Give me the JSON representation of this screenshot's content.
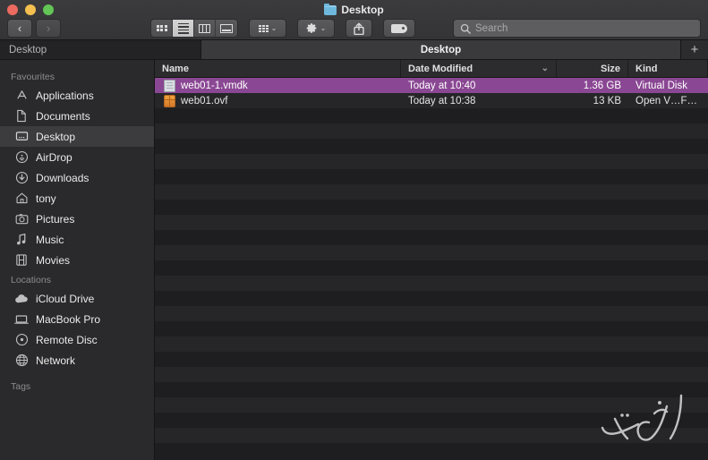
{
  "window": {
    "title": "Desktop",
    "title_icon": "folder-icon",
    "traffic_lights": [
      {
        "name": "close-button",
        "color": "#ec6a5f"
      },
      {
        "name": "minimize-button",
        "color": "#f5bf4f"
      },
      {
        "name": "zoom-button",
        "color": "#62c555"
      }
    ]
  },
  "toolbar": {
    "back_label": "‹",
    "forward_label": "›",
    "view_modes": [
      {
        "name": "icon-view",
        "icon": "grid-icon",
        "active": false
      },
      {
        "name": "list-view",
        "icon": "list-icon",
        "active": true
      },
      {
        "name": "column-view",
        "icon": "columns-icon",
        "active": false
      },
      {
        "name": "gallery-view",
        "icon": "gallery-icon",
        "active": false
      }
    ],
    "group_icon": "group-by-icon",
    "group_chevron": "⌄",
    "action_icon": "gear-icon",
    "action_chevron": "⌄",
    "share_icon": "share-icon",
    "tag_icon": "tag-icon"
  },
  "search": {
    "icon": "search-icon",
    "placeholder": "Search",
    "value": ""
  },
  "tabs": {
    "items": [
      {
        "label": "Desktop",
        "active": false
      },
      {
        "label": "Desktop",
        "active": true
      }
    ],
    "new_tab_label": "+"
  },
  "sidebar": {
    "groups": [
      {
        "title": "Favourites",
        "items": [
          {
            "label": "Applications",
            "icon": "applications-icon",
            "selected": false
          },
          {
            "label": "Documents",
            "icon": "documents-icon",
            "selected": false
          },
          {
            "label": "Desktop",
            "icon": "desktop-icon",
            "selected": true
          },
          {
            "label": "AirDrop",
            "icon": "airdrop-icon",
            "selected": false
          },
          {
            "label": "Downloads",
            "icon": "downloads-icon",
            "selected": false
          },
          {
            "label": "tony",
            "icon": "home-icon",
            "selected": false
          },
          {
            "label": "Pictures",
            "icon": "pictures-icon",
            "selected": false
          },
          {
            "label": "Music",
            "icon": "music-icon",
            "selected": false
          },
          {
            "label": "Movies",
            "icon": "movies-icon",
            "selected": false
          }
        ]
      },
      {
        "title": "Locations",
        "items": [
          {
            "label": "iCloud Drive",
            "icon": "icloud-icon",
            "selected": false
          },
          {
            "label": "MacBook Pro",
            "icon": "laptop-icon",
            "selected": false
          },
          {
            "label": "Remote Disc",
            "icon": "disc-icon",
            "selected": false
          },
          {
            "label": "Network",
            "icon": "network-icon",
            "selected": false
          }
        ]
      },
      {
        "title": "Tags",
        "items": []
      }
    ]
  },
  "file_list": {
    "columns": [
      {
        "key": "name",
        "label": "Name"
      },
      {
        "key": "date",
        "label": "Date Modified",
        "sort_chevron": "⌄"
      },
      {
        "key": "size",
        "label": "Size"
      },
      {
        "key": "kind",
        "label": "Kind"
      }
    ],
    "rows": [
      {
        "name": "web01-1.vmdk",
        "date": "Today at 10:40",
        "size": "1.36 GB",
        "kind": "Virtual Disk",
        "icon": "document-icon",
        "selected": true
      },
      {
        "name": "web01.ovf",
        "date": "Today at 10:38",
        "size": "13 KB",
        "kind": "Open V…Format",
        "icon": "package-icon",
        "selected": false
      }
    ],
    "selection_color": "#8a4793",
    "empty_row_count": 23
  },
  "watermark": {
    "name": "calligraphy-watermark"
  }
}
